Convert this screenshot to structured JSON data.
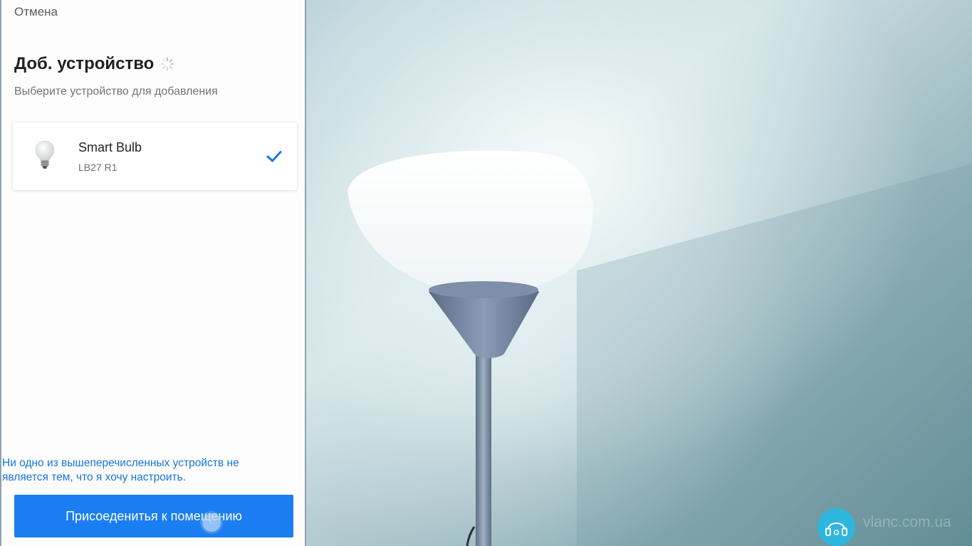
{
  "header": {
    "cancel_label": "Отмена",
    "title": "Доб. устройство",
    "subtitle": "Выберите устройство для добавления"
  },
  "devices": [
    {
      "name": "Smart Bulb",
      "model": "LB27 R1",
      "icon": "light-bulb-icon",
      "selected": true
    }
  ],
  "footer": {
    "not_listed_text": "Ни одно из вышеперечисленных устройств не является тем, что я хочу настроить.",
    "join_button_label": "Присоеденитья к помещению"
  },
  "watermark": {
    "text": "vlanc.com.ua",
    "icon": "headset-icon"
  },
  "colors": {
    "accent": "#1a7ef2",
    "link": "#1775d8",
    "check": "#1a73e8"
  }
}
